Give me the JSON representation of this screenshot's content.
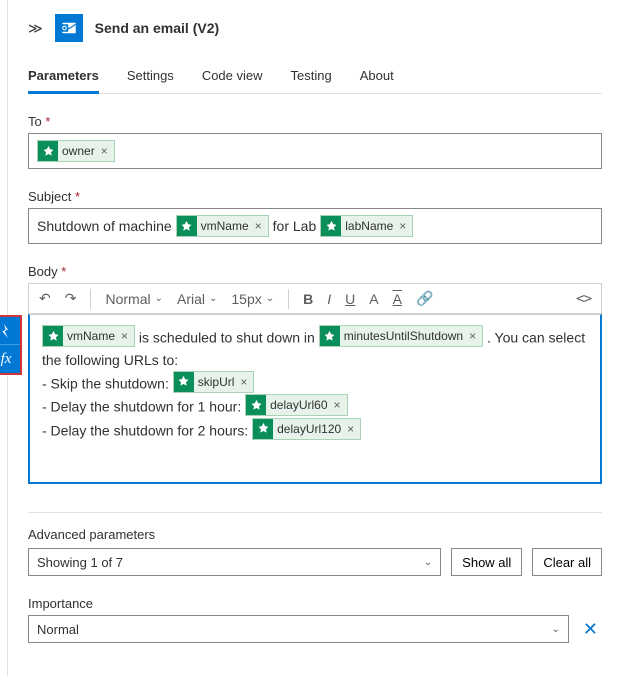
{
  "header": {
    "title": "Send an email (V2)"
  },
  "tabs": [
    "Parameters",
    "Settings",
    "Code view",
    "Testing",
    "About"
  ],
  "activeTab": "Parameters",
  "labels": {
    "to": "To",
    "subject": "Subject",
    "body": "Body",
    "advanced": "Advanced parameters",
    "importance": "Importance"
  },
  "to": {
    "tokens": [
      "owner"
    ]
  },
  "subject": {
    "prefix": "Shutdown of machine",
    "token1": "vmName",
    "mid": "for Lab",
    "token2": "labName"
  },
  "toolbar": {
    "font_style": "Normal",
    "font_family": "Arial",
    "font_size": "15px"
  },
  "body": {
    "token_vm": "vmName",
    "t1": "is scheduled to shut down in",
    "token_min": "minutesUntilShutdown",
    "t2": ". You can select the following URLs to:",
    "l_skip": "- Skip the shutdown:",
    "token_skip": "skipUrl",
    "l_d60": "- Delay the shutdown for 1 hour:",
    "token_d60": "delayUrl60",
    "l_d120": "- Delay the shutdown for 2 hours:",
    "token_d120": "delayUrl120"
  },
  "advanced": {
    "summary": "Showing 1 of 7",
    "show_all": "Show all",
    "clear_all": "Clear all"
  },
  "importance": {
    "value": "Normal"
  }
}
